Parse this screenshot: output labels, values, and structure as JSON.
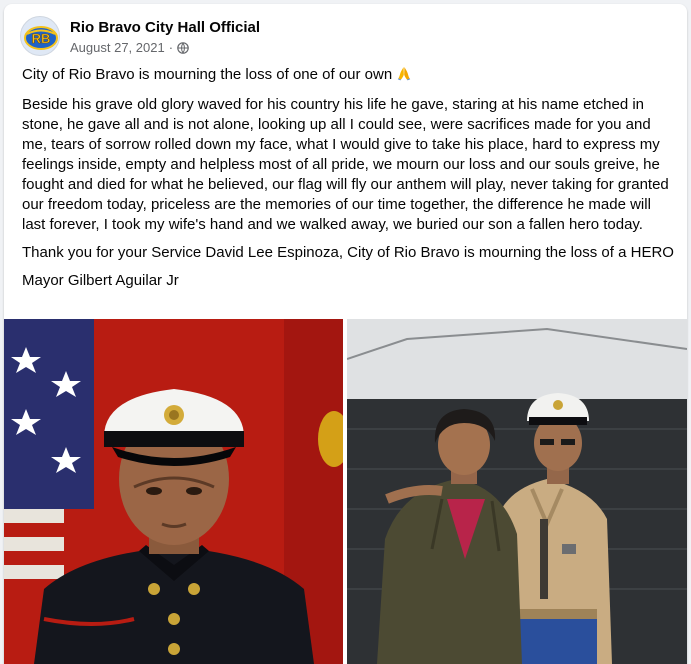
{
  "post": {
    "author": "Rio Bravo City Hall Official",
    "avatar_text": "RB",
    "date": "August 27, 2021",
    "separator": "·",
    "privacy_icon": "globe-icon",
    "headline": "City of Rio Bravo is mourning the loss of one of our own",
    "headline_emoji": "folded-hands-icon",
    "poem": "Beside his grave old glory waved for his country his life he gave, staring at his name etched in stone, he gave all and is not alone, looking up all I could see, were sacrifices made for you and me, tears of sorrow rolled down my face, what I would give to take his place, hard to express my feelings inside, empty and helpless most of all pride, we mourn our loss and our souls greive, he fought and died for what he believed, our flag will fly our anthem will play, never taking for granted our freedom today, priceless are the memories of our time together, the difference he made will last forever, I took my wife's hand and we walked away, we buried our son a fallen hero today.",
    "thanks": "Thank you for your Service David Lee Espinoza, City of Rio Bravo is mourning the loss of a HERO",
    "signature": "Mayor Gilbert Aguilar Jr"
  },
  "photos": [
    {
      "subject": "marine-portrait-photo"
    },
    {
      "subject": "mother-and-son-photo"
    }
  ],
  "colors": {
    "text": "#050505",
    "meta": "#65676b",
    "background": "#f0f2f5",
    "card": "#ffffff"
  }
}
